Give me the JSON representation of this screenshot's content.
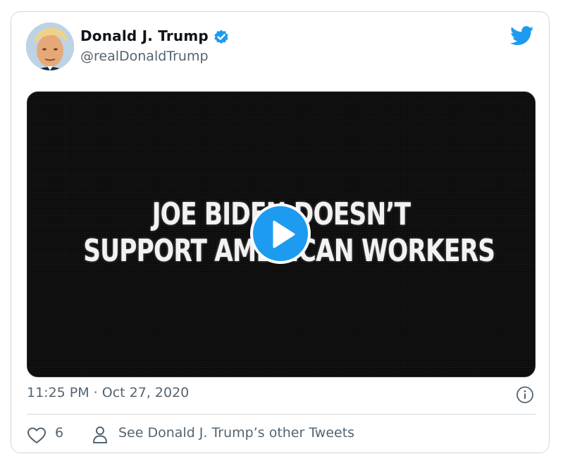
{
  "tweet": {
    "author_name": "Donald J. Trump",
    "author_handle": "@realDonaldTrump",
    "verified": true,
    "timestamp": "11:25 PM · Oct 27, 2020",
    "like_count": "6",
    "other_tweets_link": "See Donald J. Trump’s other Tweets"
  },
  "media": {
    "type": "video",
    "headline_line1": "JOE BIDEN DOESN’T",
    "headline_line2": "SUPPORT AMERICAN WORKERS"
  },
  "colors": {
    "accent": "#1d9bf0",
    "muted_text": "#536471",
    "border": "#cfd9de"
  },
  "icons": [
    "twitter-bird-icon",
    "verified-badge-icon",
    "play-icon",
    "info-icon",
    "heart-icon",
    "person-icon"
  ]
}
